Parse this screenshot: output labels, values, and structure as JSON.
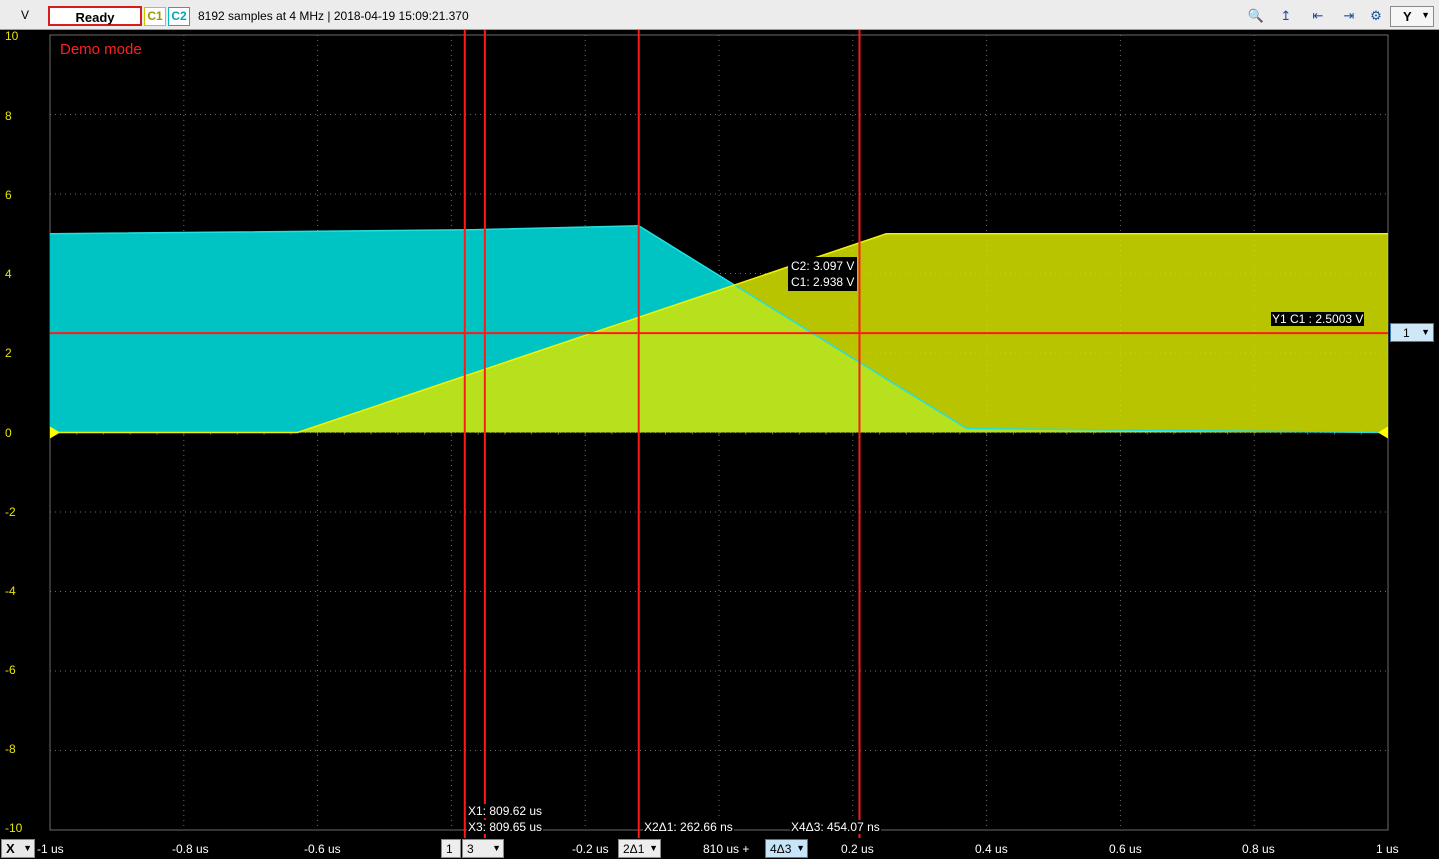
{
  "toolbar": {
    "axis_unit": "V",
    "status": "Ready",
    "channels": [
      {
        "label": "C1",
        "color": "#ffff00"
      },
      {
        "label": "C2",
        "color": "#00d0d8"
      }
    ],
    "acquisition_info": "8192 samples at 4 MHz | 2018-04-19 15:09:21.370",
    "icons": [
      "zoom-icon",
      "cursor-x-icon",
      "cursor-y-icon",
      "cursor-xy-icon",
      "settings-icon"
    ],
    "y_axis_button": "Y"
  },
  "overlay": {
    "demo_mode": "Demo mode"
  },
  "axes": {
    "y_ticks": [
      "10",
      "8",
      "6",
      "4",
      "2",
      "0",
      "-2",
      "-4",
      "-6",
      "-8",
      "-10"
    ],
    "x_ticks": [
      "-0.8 us",
      "-0.6 us",
      "0.2 us",
      "0.4 us",
      "0.6 us",
      "0.8 us",
      "1 us"
    ],
    "x_origin_label": "810 us +",
    "x_ticks_around_cursor": {
      "left": "-0.2 us"
    }
  },
  "bottom_bar": {
    "x_axis_button": "X",
    "x_start": "-1 us",
    "cursor_selector_1": "1",
    "cursor_selector_3": "3",
    "cursor_selector_2d1": "2Δ1",
    "cursor_selector_4d3": "4Δ3"
  },
  "cursors": {
    "x1": "X1: 809.62 us",
    "x3": "X3: 809.65 us",
    "x2d1": "X2Δ1: 262.66 ns",
    "x4d3": "X4Δ3: 454.07 ns",
    "y1": "Y1 C1 : 2.5003 V",
    "y_selector": "1"
  },
  "tooltip": {
    "c2": "C2: 3.097 V",
    "c1": "C1: 2.938 V"
  },
  "chart_data": {
    "type": "line",
    "x_unit": "us (relative to 810 us)",
    "ylim": [
      -10,
      10
    ],
    "xlim": [
      -1,
      1
    ],
    "series": [
      {
        "name": "C1",
        "color": "#c8c800",
        "x": [
          -1,
          -0.63,
          0.25,
          0.62,
          1
        ],
        "y": [
          0,
          0,
          5.0,
          5.0,
          5.0
        ]
      },
      {
        "name": "C2",
        "color": "#00c8c8",
        "x": [
          -1,
          -0.37,
          -0.12,
          0.37,
          1
        ],
        "y": [
          5.0,
          5.1,
          5.2,
          0.1,
          0.0
        ]
      }
    ],
    "cursor_lines": {
      "x": [
        -0.38,
        -0.35,
        -0.12,
        0.21
      ],
      "y": [
        2.5003
      ]
    }
  }
}
